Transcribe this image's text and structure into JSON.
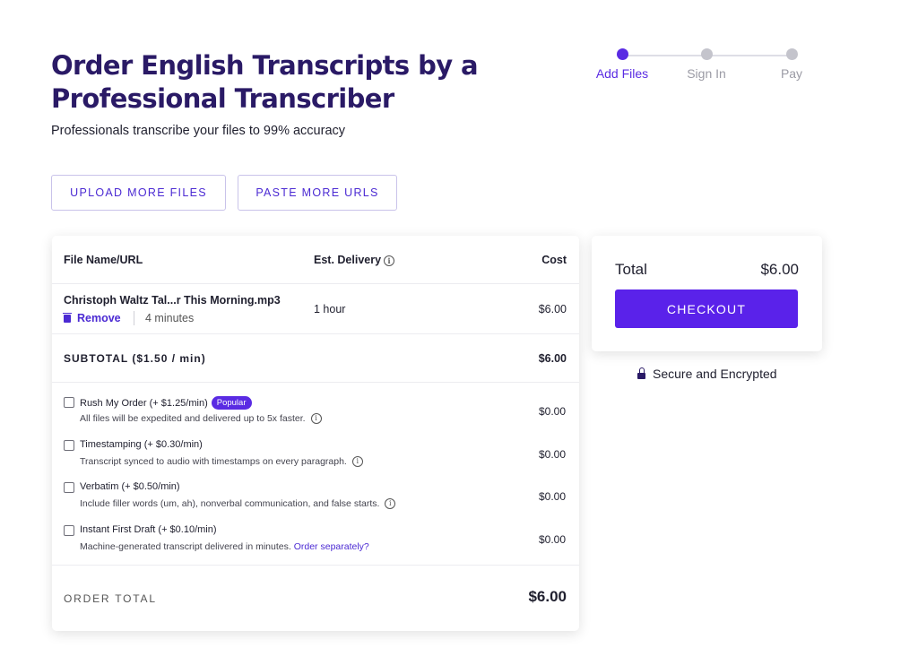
{
  "page": {
    "title": "Order English Transcripts by a Professional Transcriber",
    "subtitle": "Professionals transcribe your files to 99% accuracy"
  },
  "steps": [
    {
      "label": "Add Files",
      "active": true
    },
    {
      "label": "Sign In",
      "active": false
    },
    {
      "label": "Pay",
      "active": false
    }
  ],
  "actions": {
    "upload_label": "UPLOAD MORE FILES",
    "paste_label": "PASTE MORE URLS"
  },
  "table": {
    "col_file": "File Name/URL",
    "col_delivery": "Est. Delivery",
    "col_cost": "Cost",
    "file": {
      "name": "Christoph Waltz Tal...r This Morning.mp3",
      "remove_label": "Remove",
      "duration": "4 minutes",
      "delivery": "1 hour",
      "cost": "$6.00"
    },
    "subtotal_label": "SUBTOTAL ($1.50 / min)",
    "subtotal_value": "$6.00",
    "addons": [
      {
        "name": "Rush My Order (+ $1.25/min)",
        "badge": "Popular",
        "description": "All files will be expedited and delivered up to 5x faster.",
        "cost": "$0.00",
        "checked": false
      },
      {
        "name": "Timestamping (+ $0.30/min)",
        "description": "Transcript synced to audio with timestamps on every paragraph.",
        "cost": "$0.00",
        "checked": false
      },
      {
        "name": "Verbatim (+ $0.50/min)",
        "description": "Include filler words (um, ah), nonverbal communication, and false starts.",
        "cost": "$0.00",
        "checked": false
      },
      {
        "name": "Instant First Draft (+ $0.10/min)",
        "description": "Machine-generated transcript delivered in minutes.",
        "link": "Order separately?",
        "cost": "$0.00",
        "checked": false
      }
    ],
    "order_total_label": "ORDER TOTAL",
    "order_total_value": "$6.00"
  },
  "summary": {
    "total_label": "Total",
    "total_value": "$6.00",
    "checkout_label": "CHECKOUT",
    "secure_label": "Secure and Encrypted"
  },
  "colors": {
    "brand": "#5a2be3",
    "title": "#2a1a66"
  },
  "icons": {
    "info": "info-icon",
    "trash": "trash-icon",
    "lock": "lock-icon"
  }
}
